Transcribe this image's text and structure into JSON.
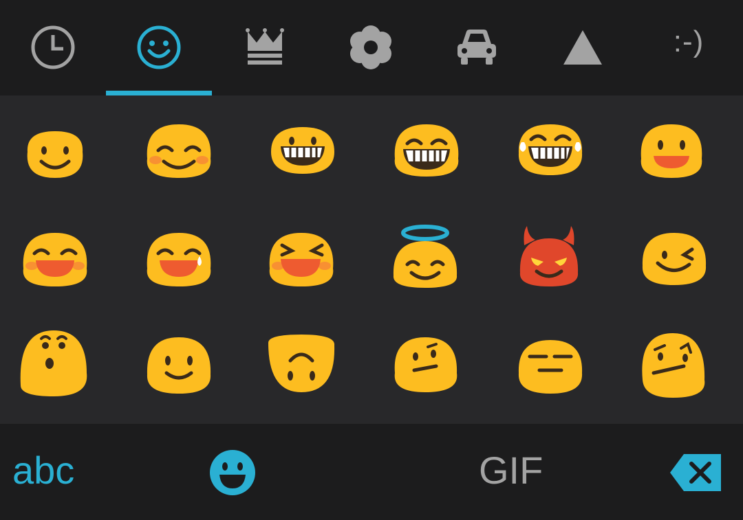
{
  "colors": {
    "accent": "#2ab0d3",
    "icon_gray": "#a3a3a3",
    "emoji_yellow": "#fdbd20",
    "emoji_red": "#e0472b",
    "background": "#28282a",
    "bar_background": "#1c1c1d"
  },
  "tabs": [
    {
      "icon": "clock-icon",
      "selected": false
    },
    {
      "icon": "smiley-icon",
      "selected": true
    },
    {
      "icon": "crown-icon",
      "selected": false
    },
    {
      "icon": "flower-icon",
      "selected": false
    },
    {
      "icon": "car-icon",
      "selected": false
    },
    {
      "icon": "triangle-icon",
      "selected": false
    },
    {
      "icon": "emoticon-text",
      "selected": false,
      "label": ":-)"
    }
  ],
  "emoji_rows": [
    [
      "slightly-smiling-face",
      "smiling-face-with-smiling-eyes",
      "grimacing-face",
      "grinning-face-with-smiling-eyes",
      "face-with-tears-of-joy",
      "smiling-face-open-mouth"
    ],
    [
      "smiling-face-open-mouth-smiling-eyes",
      "smiling-face-with-sweat",
      "laughing-squinting-face",
      "smiling-face-with-halo",
      "smiling-face-with-horns",
      "winking-face"
    ],
    [
      "hushed-face",
      "smiling-face",
      "upside-down-face",
      "face-with-raised-eyebrow",
      "expressionless-face",
      "confused-face"
    ]
  ],
  "bottom_bar": {
    "abc_label": "abc",
    "emoji_icon": "emoji-keyboard-icon",
    "gif_label": "GIF",
    "delete_icon": "backspace-icon"
  }
}
